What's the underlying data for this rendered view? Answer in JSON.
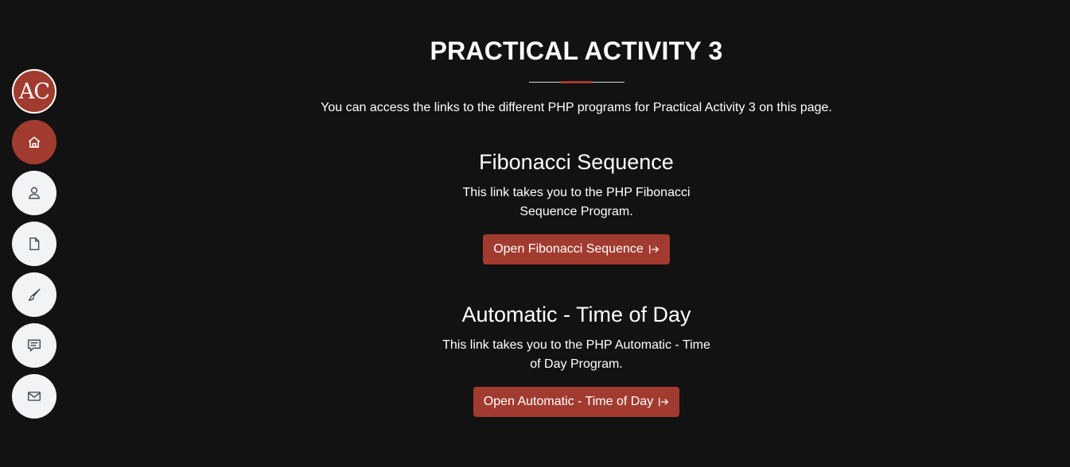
{
  "sidebar": {
    "logo_text": "AC",
    "items": [
      {
        "name": "home",
        "icon": "home-icon",
        "active": true
      },
      {
        "name": "about",
        "icon": "person-icon",
        "active": false
      },
      {
        "name": "resume",
        "icon": "file-icon",
        "active": false
      },
      {
        "name": "portfolio",
        "icon": "brush-icon",
        "active": false
      },
      {
        "name": "services",
        "icon": "chat-icon",
        "active": false
      },
      {
        "name": "contact",
        "icon": "envelope-icon",
        "active": false
      }
    ]
  },
  "main": {
    "title": "PRACTICAL ACTIVITY 3",
    "intro": "You can access the links to the different PHP programs for Practical Activity 3 on this page.",
    "sections": [
      {
        "heading": "Fibonacci Sequence",
        "text": "This link takes you to the PHP Fibonacci Sequence Program.",
        "button_label": "Open Fibonacci Sequence"
      },
      {
        "heading": "Automatic - Time of Day",
        "text": "This link takes you to the PHP Automatic - Time of Day Program.",
        "button_label": "Open Automatic - Time of Day"
      }
    ]
  },
  "colors": {
    "background": "#121212",
    "accent": "#a23b2f",
    "nav_button": "#f2f3f5",
    "text": "#ffffff"
  }
}
